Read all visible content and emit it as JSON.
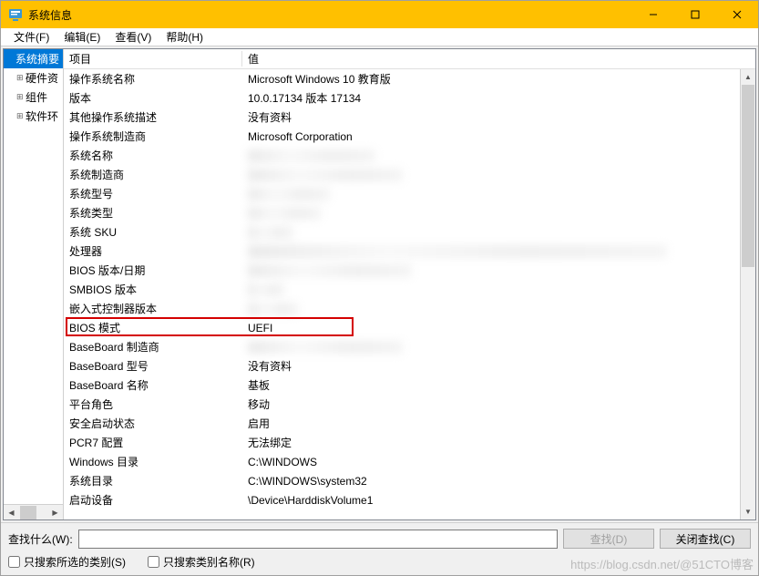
{
  "titlebar": {
    "title": "系统信息"
  },
  "menubar": [
    {
      "label": "文件(F)"
    },
    {
      "label": "编辑(E)"
    },
    {
      "label": "查看(V)"
    },
    {
      "label": "帮助(H)"
    }
  ],
  "tree": [
    {
      "label": "系统摘要",
      "selected": true,
      "depth": 0,
      "expander": ""
    },
    {
      "label": "硬件资",
      "depth": 1,
      "expander": "⊞"
    },
    {
      "label": "组件",
      "depth": 1,
      "expander": "⊞"
    },
    {
      "label": "软件环",
      "depth": 1,
      "expander": "⊞"
    }
  ],
  "columns": {
    "col1": "项目",
    "col2": "值"
  },
  "rows": [
    {
      "name": "操作系统名称",
      "value": "Microsoft Windows 10 教育版",
      "blur": false
    },
    {
      "name": "版本",
      "value": "10.0.17134 版本 17134",
      "blur": false
    },
    {
      "name": "其他操作系统描述",
      "value": "没有资料",
      "blur": false
    },
    {
      "name": "操作系统制造商",
      "value": "Microsoft Corporation",
      "blur": false
    },
    {
      "name": "系统名称",
      "value": "",
      "blur": true,
      "bw": 140
    },
    {
      "name": "系统制造商",
      "value": "",
      "blur": true,
      "bw": 170
    },
    {
      "name": "系统型号",
      "value": "",
      "blur": true,
      "bw": 90
    },
    {
      "name": "系统类型",
      "value": "",
      "blur": true,
      "bw": 80
    },
    {
      "name": "系统 SKU",
      "value": "",
      "blur": true,
      "bw": 50
    },
    {
      "name": "处理器",
      "value": "",
      "blur": true,
      "bw": 460
    },
    {
      "name": "BIOS 版本/日期",
      "value": "",
      "blur": true,
      "bw": 180
    },
    {
      "name": "SMBIOS 版本",
      "value": "",
      "blur": true,
      "bw": 40
    },
    {
      "name": "嵌入式控制器版本",
      "value": "",
      "blur": true,
      "bw": 55
    },
    {
      "name": "BIOS 模式",
      "value": "UEFI",
      "blur": false,
      "highlight": true
    },
    {
      "name": "BaseBoard 制造商",
      "value": "",
      "blur": true,
      "bw": 170
    },
    {
      "name": "BaseBoard 型号",
      "value": "没有资料",
      "blur": false
    },
    {
      "name": "BaseBoard 名称",
      "value": "基板",
      "blur": false
    },
    {
      "name": "平台角色",
      "value": "移动",
      "blur": false
    },
    {
      "name": "安全启动状态",
      "value": "启用",
      "blur": false
    },
    {
      "name": "PCR7 配置",
      "value": "无法绑定",
      "blur": false
    },
    {
      "name": "Windows 目录",
      "value": "C:\\WINDOWS",
      "blur": false
    },
    {
      "name": "系统目录",
      "value": "C:\\WINDOWS\\system32",
      "blur": false
    },
    {
      "name": "启动设备",
      "value": "\\Device\\HarddiskVolume1",
      "blur": false
    }
  ],
  "footer": {
    "search_label": "查找什么(W):",
    "search_value": "",
    "find_btn": "查找(D)",
    "close_find_btn": "关闭查找(C)",
    "cb1": "只搜索所选的类别(S)",
    "cb2": "只搜索类别名称(R)"
  },
  "watermark": "https://blog.csdn.net/@51CTO博客"
}
